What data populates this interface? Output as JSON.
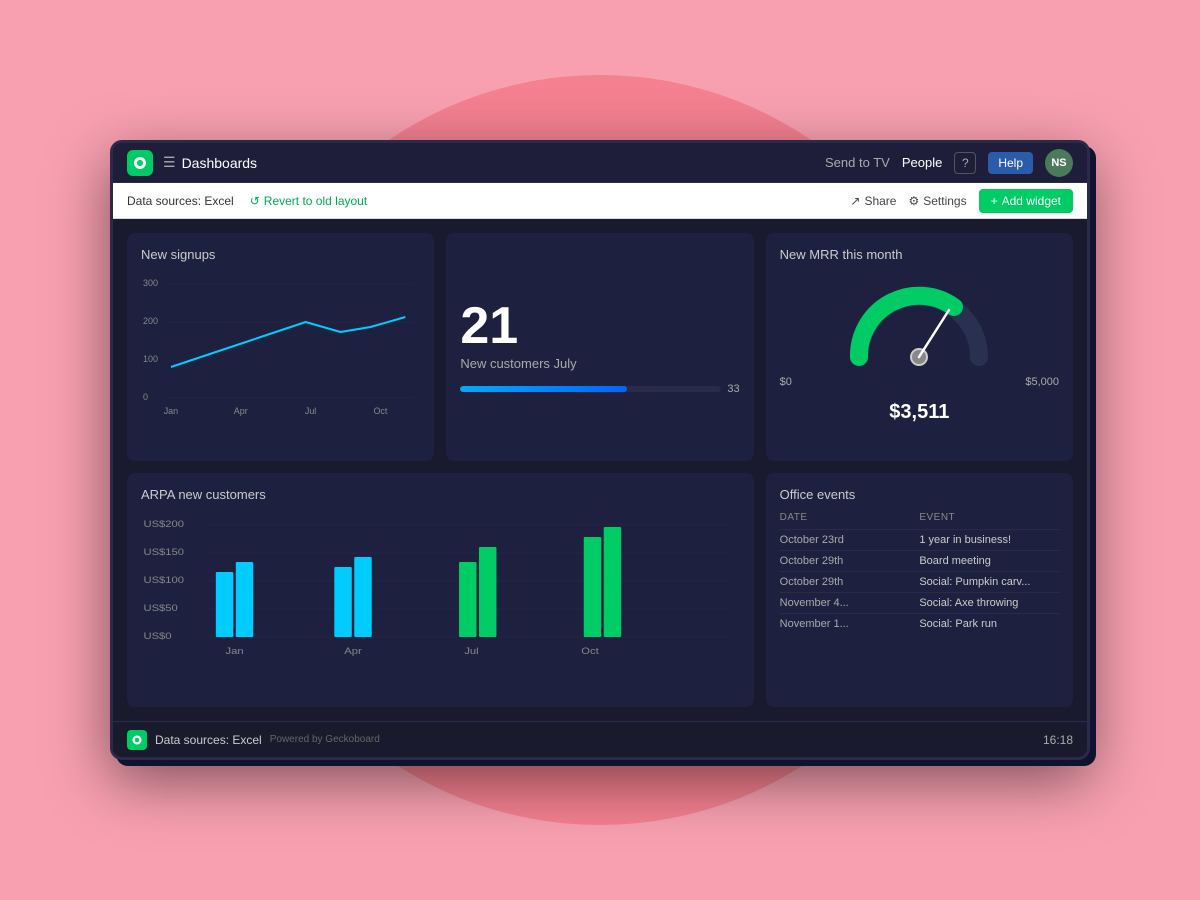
{
  "navbar": {
    "logo_alt": "Geckoboard logo",
    "hamburger": "☰",
    "title": "Dashboards",
    "send_to_tv": "Send to TV",
    "people": "People",
    "help_icon": "?",
    "help_label": "Help",
    "avatar": "NS"
  },
  "toolbar": {
    "datasource": "Data sources: Excel",
    "revert_icon": "↺",
    "revert_label": "Revert to old layout",
    "share_icon": "↗",
    "share_label": "Share",
    "settings_icon": "⚙",
    "settings_label": "Settings",
    "add_widget_icon": "+",
    "add_widget_label": "Add widget"
  },
  "widgets": {
    "signups": {
      "title": "New signups",
      "y_labels": [
        "300",
        "200",
        "100",
        "0"
      ],
      "x_labels": [
        "Jan",
        "Apr",
        "Jul",
        "Oct"
      ]
    },
    "customers": {
      "number": "21",
      "label": "New customers July",
      "progress_start": "70%",
      "progress_end": "33"
    },
    "mrr": {
      "title": "New MRR this month",
      "min_label": "$0",
      "max_label": "$5,000",
      "value_prefix": "$",
      "value": "3,511"
    },
    "arpa": {
      "title": "ARPA new customers",
      "y_labels": [
        "US$200",
        "US$150",
        "US$100",
        "US$50",
        "US$0"
      ],
      "x_labels": [
        "Jan",
        "Apr",
        "Jul",
        "Oct"
      ]
    },
    "events": {
      "title": "Office events",
      "col_date": "Date",
      "col_event": "Event",
      "rows": [
        {
          "date": "October 23rd",
          "event": "1 year in business!"
        },
        {
          "date": "October 29th",
          "event": "Board meeting"
        },
        {
          "date": "October 29th",
          "event": "Social: Pumpkin carv..."
        },
        {
          "date": "November 4...",
          "event": "Social: Axe throwing"
        },
        {
          "date": "November 1...",
          "event": "Social: Park run"
        }
      ]
    }
  },
  "footer": {
    "datasource": "Data sources: Excel",
    "powered": "Powered by Geckoboard",
    "time": "16:18"
  }
}
